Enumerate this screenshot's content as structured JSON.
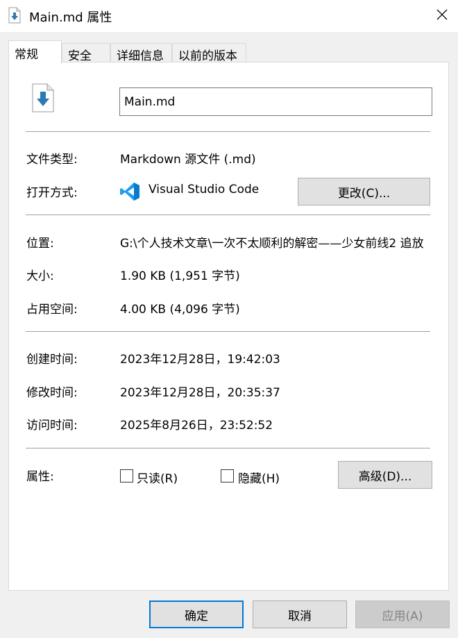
{
  "window": {
    "title": "Main.md 属性"
  },
  "tabs": [
    {
      "label": "常规",
      "active": true
    },
    {
      "label": "安全",
      "active": false
    },
    {
      "label": "详细信息",
      "active": false
    },
    {
      "label": "以前的版本",
      "active": false
    }
  ],
  "general": {
    "file_name": "Main.md",
    "file_type_label": "文件类型:",
    "file_type_value": "Markdown 源文件 (.md)",
    "opens_with_label": "打开方式:",
    "opens_with_app": "Visual Studio Code",
    "change_button": "更改(C)...",
    "location_label": "位置:",
    "location_value": "G:\\个人技术文章\\一次不太顺利的解密——少女前线2 追放",
    "size_label": "大小:",
    "size_value": "1.90 KB (1,951 字节)",
    "size_on_disk_label": "占用空间:",
    "size_on_disk_value": "4.00 KB (4,096 字节)",
    "created_label": "创建时间:",
    "created_value": "2023年12月28日，19:42:03",
    "modified_label": "修改时间:",
    "modified_value": "2023年12月28日，20:35:37",
    "accessed_label": "访问时间:",
    "accessed_value": "2025年8月26日，23:52:52",
    "attributes_label": "属性:",
    "readonly_label": "只读(R)",
    "readonly_checked": false,
    "hidden_label": "隐藏(H)",
    "hidden_checked": false,
    "advanced_button": "高级(D)..."
  },
  "footer": {
    "ok_button": "确定",
    "cancel_button": "取消",
    "apply_button": "应用(A)"
  },
  "icons": {
    "title": "markdown-file-icon",
    "close": "close-icon",
    "file": "markdown-file-icon",
    "app": "vscode-icon"
  },
  "colors": {
    "accent": "#0078d7",
    "file_arrow": "#2b79b5",
    "vscode_blue": "#0a7acc"
  }
}
